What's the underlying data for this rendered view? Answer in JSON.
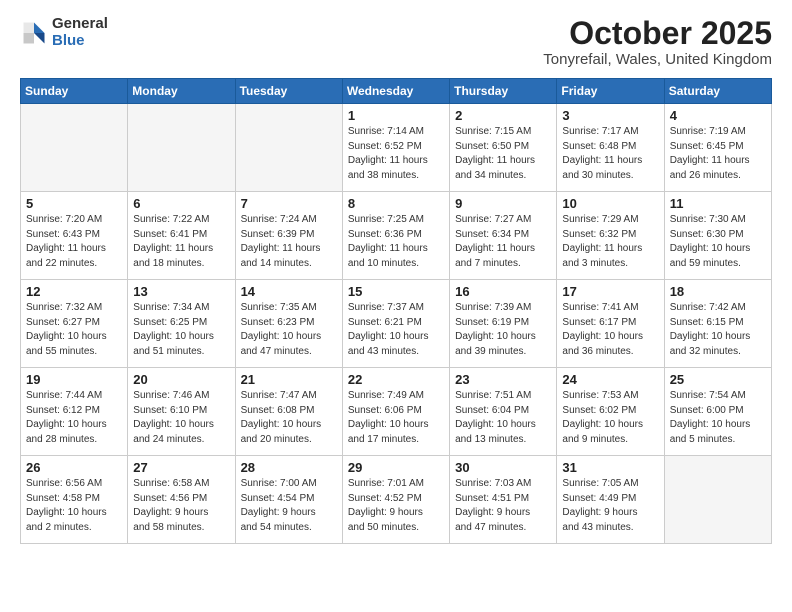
{
  "header": {
    "logo_general": "General",
    "logo_blue": "Blue",
    "month_title": "October 2025",
    "location": "Tonyrefail, Wales, United Kingdom"
  },
  "weekdays": [
    "Sunday",
    "Monday",
    "Tuesday",
    "Wednesday",
    "Thursday",
    "Friday",
    "Saturday"
  ],
  "weeks": [
    [
      {
        "day": "",
        "info": ""
      },
      {
        "day": "",
        "info": ""
      },
      {
        "day": "",
        "info": ""
      },
      {
        "day": "1",
        "info": "Sunrise: 7:14 AM\nSunset: 6:52 PM\nDaylight: 11 hours\nand 38 minutes."
      },
      {
        "day": "2",
        "info": "Sunrise: 7:15 AM\nSunset: 6:50 PM\nDaylight: 11 hours\nand 34 minutes."
      },
      {
        "day": "3",
        "info": "Sunrise: 7:17 AM\nSunset: 6:48 PM\nDaylight: 11 hours\nand 30 minutes."
      },
      {
        "day": "4",
        "info": "Sunrise: 7:19 AM\nSunset: 6:45 PM\nDaylight: 11 hours\nand 26 minutes."
      }
    ],
    [
      {
        "day": "5",
        "info": "Sunrise: 7:20 AM\nSunset: 6:43 PM\nDaylight: 11 hours\nand 22 minutes."
      },
      {
        "day": "6",
        "info": "Sunrise: 7:22 AM\nSunset: 6:41 PM\nDaylight: 11 hours\nand 18 minutes."
      },
      {
        "day": "7",
        "info": "Sunrise: 7:24 AM\nSunset: 6:39 PM\nDaylight: 11 hours\nand 14 minutes."
      },
      {
        "day": "8",
        "info": "Sunrise: 7:25 AM\nSunset: 6:36 PM\nDaylight: 11 hours\nand 10 minutes."
      },
      {
        "day": "9",
        "info": "Sunrise: 7:27 AM\nSunset: 6:34 PM\nDaylight: 11 hours\nand 7 minutes."
      },
      {
        "day": "10",
        "info": "Sunrise: 7:29 AM\nSunset: 6:32 PM\nDaylight: 11 hours\nand 3 minutes."
      },
      {
        "day": "11",
        "info": "Sunrise: 7:30 AM\nSunset: 6:30 PM\nDaylight: 10 hours\nand 59 minutes."
      }
    ],
    [
      {
        "day": "12",
        "info": "Sunrise: 7:32 AM\nSunset: 6:27 PM\nDaylight: 10 hours\nand 55 minutes."
      },
      {
        "day": "13",
        "info": "Sunrise: 7:34 AM\nSunset: 6:25 PM\nDaylight: 10 hours\nand 51 minutes."
      },
      {
        "day": "14",
        "info": "Sunrise: 7:35 AM\nSunset: 6:23 PM\nDaylight: 10 hours\nand 47 minutes."
      },
      {
        "day": "15",
        "info": "Sunrise: 7:37 AM\nSunset: 6:21 PM\nDaylight: 10 hours\nand 43 minutes."
      },
      {
        "day": "16",
        "info": "Sunrise: 7:39 AM\nSunset: 6:19 PM\nDaylight: 10 hours\nand 39 minutes."
      },
      {
        "day": "17",
        "info": "Sunrise: 7:41 AM\nSunset: 6:17 PM\nDaylight: 10 hours\nand 36 minutes."
      },
      {
        "day": "18",
        "info": "Sunrise: 7:42 AM\nSunset: 6:15 PM\nDaylight: 10 hours\nand 32 minutes."
      }
    ],
    [
      {
        "day": "19",
        "info": "Sunrise: 7:44 AM\nSunset: 6:12 PM\nDaylight: 10 hours\nand 28 minutes."
      },
      {
        "day": "20",
        "info": "Sunrise: 7:46 AM\nSunset: 6:10 PM\nDaylight: 10 hours\nand 24 minutes."
      },
      {
        "day": "21",
        "info": "Sunrise: 7:47 AM\nSunset: 6:08 PM\nDaylight: 10 hours\nand 20 minutes."
      },
      {
        "day": "22",
        "info": "Sunrise: 7:49 AM\nSunset: 6:06 PM\nDaylight: 10 hours\nand 17 minutes."
      },
      {
        "day": "23",
        "info": "Sunrise: 7:51 AM\nSunset: 6:04 PM\nDaylight: 10 hours\nand 13 minutes."
      },
      {
        "day": "24",
        "info": "Sunrise: 7:53 AM\nSunset: 6:02 PM\nDaylight: 10 hours\nand 9 minutes."
      },
      {
        "day": "25",
        "info": "Sunrise: 7:54 AM\nSunset: 6:00 PM\nDaylight: 10 hours\nand 5 minutes."
      }
    ],
    [
      {
        "day": "26",
        "info": "Sunrise: 6:56 AM\nSunset: 4:58 PM\nDaylight: 10 hours\nand 2 minutes."
      },
      {
        "day": "27",
        "info": "Sunrise: 6:58 AM\nSunset: 4:56 PM\nDaylight: 9 hours\nand 58 minutes."
      },
      {
        "day": "28",
        "info": "Sunrise: 7:00 AM\nSunset: 4:54 PM\nDaylight: 9 hours\nand 54 minutes."
      },
      {
        "day": "29",
        "info": "Sunrise: 7:01 AM\nSunset: 4:52 PM\nDaylight: 9 hours\nand 50 minutes."
      },
      {
        "day": "30",
        "info": "Sunrise: 7:03 AM\nSunset: 4:51 PM\nDaylight: 9 hours\nand 47 minutes."
      },
      {
        "day": "31",
        "info": "Sunrise: 7:05 AM\nSunset: 4:49 PM\nDaylight: 9 hours\nand 43 minutes."
      },
      {
        "day": "",
        "info": ""
      }
    ]
  ]
}
